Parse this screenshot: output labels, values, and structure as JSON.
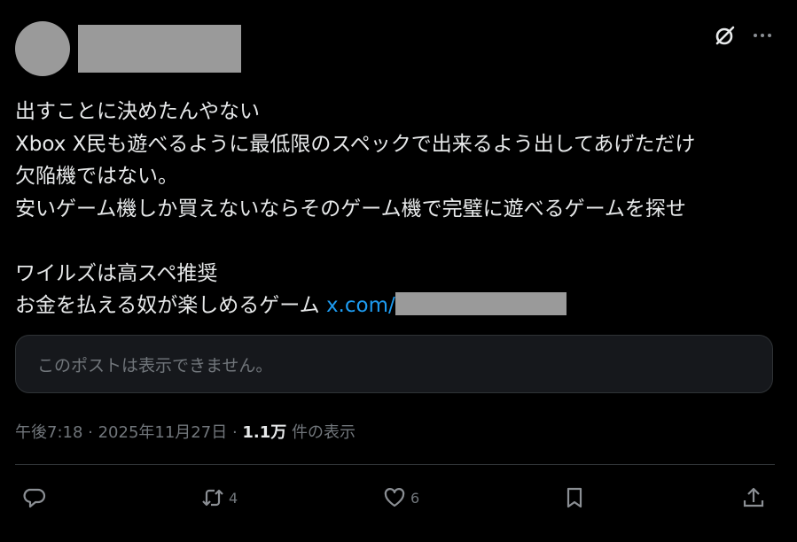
{
  "post": {
    "lines": [
      "出すことに決めたんやない",
      "Xbox X民も遊べるように最低限のスペックで出来るよう出してあげただけ",
      "欠陥機ではない。",
      "安いゲーム機しか買えないならそのゲーム機で完璧に遊べるゲームを探せ",
      "",
      "ワイルズは高スペ推奨",
      "お金を払える奴が楽しめるゲーム"
    ],
    "link_text": "x.com/"
  },
  "quote": {
    "unavailable_text": "このポストは表示できません。"
  },
  "meta": {
    "time": "午後7:18",
    "sep": " · ",
    "date": "2025年11月27日",
    "views_count": "1.1万",
    "views_label": " 件の表示"
  },
  "actions": {
    "reply_count": "",
    "repost_count": "4",
    "like_count": "6"
  },
  "icons": {
    "grok": "grok-icon",
    "more": "more-icon",
    "reply": "reply-icon",
    "repost": "repost-icon",
    "like": "heart-icon",
    "bookmark": "bookmark-icon",
    "share": "share-icon"
  },
  "colors": {
    "background": "#000000",
    "text": "#e7e9ea",
    "muted": "#71767b",
    "link": "#1d9bf0",
    "redaction": "#9a9a9a"
  }
}
